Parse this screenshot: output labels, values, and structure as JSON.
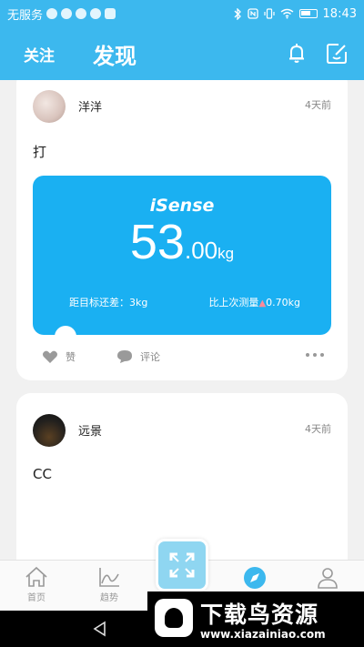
{
  "status_bar": {
    "carrier": "无服务",
    "time": "18:43"
  },
  "header": {
    "follow_tab": "关注",
    "discover_tab": "发现",
    "bell_icon": "bell-icon",
    "edit_icon": "edit-icon"
  },
  "posts": [
    {
      "username": "洋洋",
      "time": "4天前",
      "text": "打",
      "scale": {
        "brand_prefix": "i",
        "brand_rest": "Sense",
        "weight_int": "53",
        "weight_dec": ".00",
        "unit": "kg",
        "goal_label": "距目标还差：",
        "goal_value": "3kg",
        "change_label": "比上次测量",
        "change_value": "0.70kg"
      },
      "like_label": "赞",
      "comment_label": "评论"
    },
    {
      "username": "远景",
      "time": "4天前",
      "text": "CC"
    }
  ],
  "tabbar": {
    "home": "首页",
    "trend": "趋势",
    "discover": "",
    "me": ""
  },
  "watermark": {
    "title": "下载鸟资源",
    "url": "www.xiazainiao.com"
  },
  "colors": {
    "primary": "#3cb8ee",
    "scale_card": "#1ab0f2",
    "background": "#f1f1f1"
  }
}
